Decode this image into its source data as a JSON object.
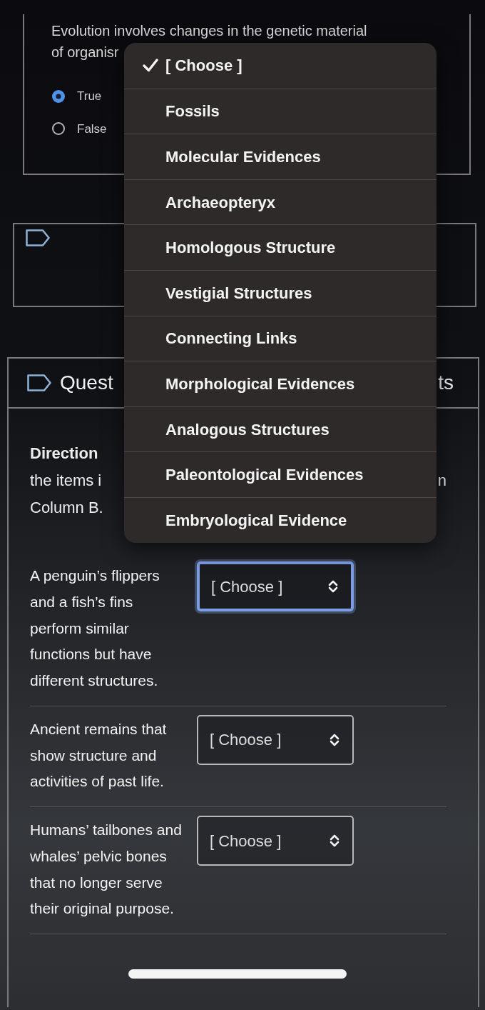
{
  "questions": [
    {
      "kind": "true_false",
      "text": "Evolution involves changes in the genetic material\nof organisr",
      "options": [
        {
          "label": "True",
          "selected": true
        },
        {
          "label": "False",
          "selected": false
        }
      ]
    },
    {
      "kind": "blank"
    },
    {
      "kind": "matching",
      "title": "Quest",
      "header_end": "ts",
      "directions_lines": [
        "Direction",
        "the items i",
        "Column B."
      ],
      "directions_tail": "n",
      "rows": [
        {
          "prompt": "A penguin’s flippers and a fish’s fins perform similar functions but have different structures.",
          "select": {
            "value": "[ Choose ]",
            "focused": true
          }
        },
        {
          "prompt": "Ancient remains that show structure and activities of past life.",
          "select": {
            "value": "[ Choose ]",
            "focused": false
          }
        },
        {
          "prompt": "Humans’ tailbones and whales’ pelvic bones that no longer serve their original purpose.",
          "select": {
            "value": "[ Choose ]",
            "focused": false
          }
        }
      ]
    }
  ],
  "dropdown": {
    "options": [
      {
        "label": "[ Choose ]",
        "selected": true
      },
      {
        "label": "Fossils",
        "selected": false
      },
      {
        "label": "Molecular Evidences",
        "selected": false
      },
      {
        "label": "Archaeopteryx",
        "selected": false
      },
      {
        "label": "Homologous Structure",
        "selected": false
      },
      {
        "label": "Vestigial Structures",
        "selected": false
      },
      {
        "label": "Connecting Links",
        "selected": false
      },
      {
        "label": "Morphological Evidences",
        "selected": false
      },
      {
        "label": "Analogous Structures",
        "selected": false
      },
      {
        "label": "Paleontological Evidences",
        "selected": false
      },
      {
        "label": "Embryological Evidence",
        "selected": false
      }
    ]
  }
}
